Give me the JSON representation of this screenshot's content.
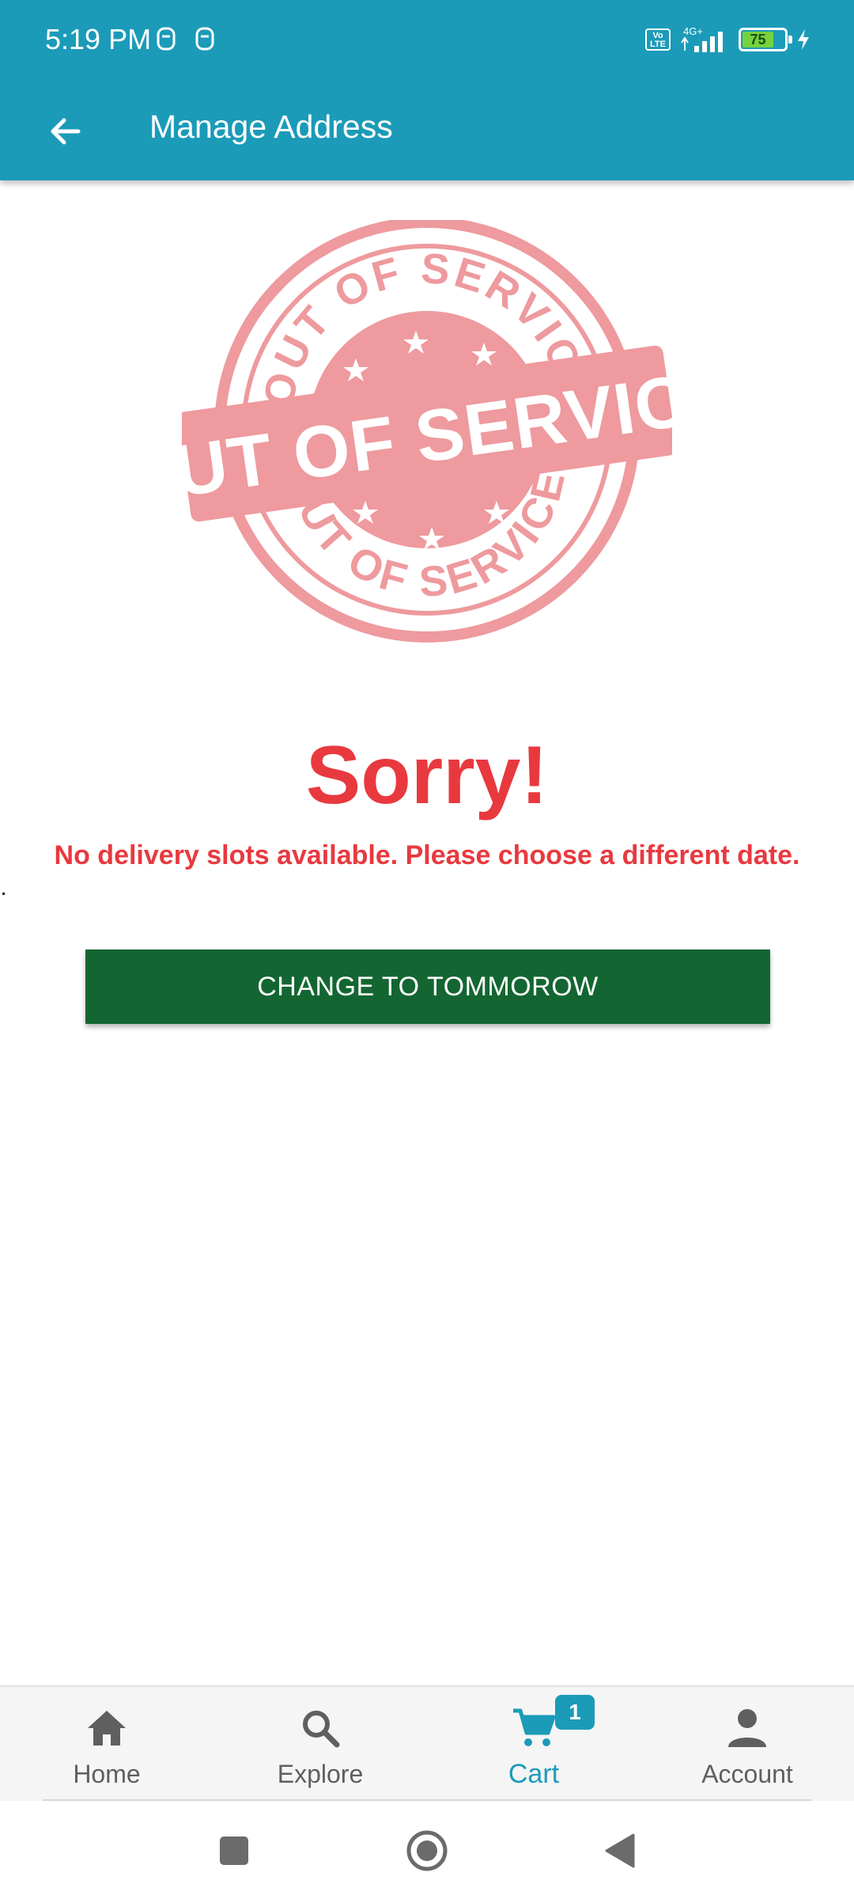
{
  "status_bar": {
    "time": "5:19 PM",
    "battery_level": "75",
    "network_label": "4G+",
    "volte_label": "Vo LTE"
  },
  "app_bar": {
    "title": "Manage Address"
  },
  "stamp": {
    "top_text": "OUT OF SERVICE",
    "band_text": "OUT OF SERVICE",
    "bottom_text": "OUT OF SERVICE",
    "color": "#ee9a9e"
  },
  "message": {
    "title": "Sorry!",
    "body": "No delivery slots available. Please choose a different date.",
    "stray_mark": "."
  },
  "actions": {
    "change_button_label": "CHANGE TO TOMMOROW"
  },
  "bottom_nav": {
    "items": [
      {
        "label": "Home",
        "icon": "home-icon"
      },
      {
        "label": "Explore",
        "icon": "search-icon"
      },
      {
        "label": "Cart",
        "icon": "cart-icon",
        "badge": "1",
        "active": true
      },
      {
        "label": "Account",
        "icon": "person-icon"
      }
    ]
  },
  "colors": {
    "primary": "#1b9bb8",
    "error_red": "#e8393f",
    "button_green": "#136631"
  }
}
